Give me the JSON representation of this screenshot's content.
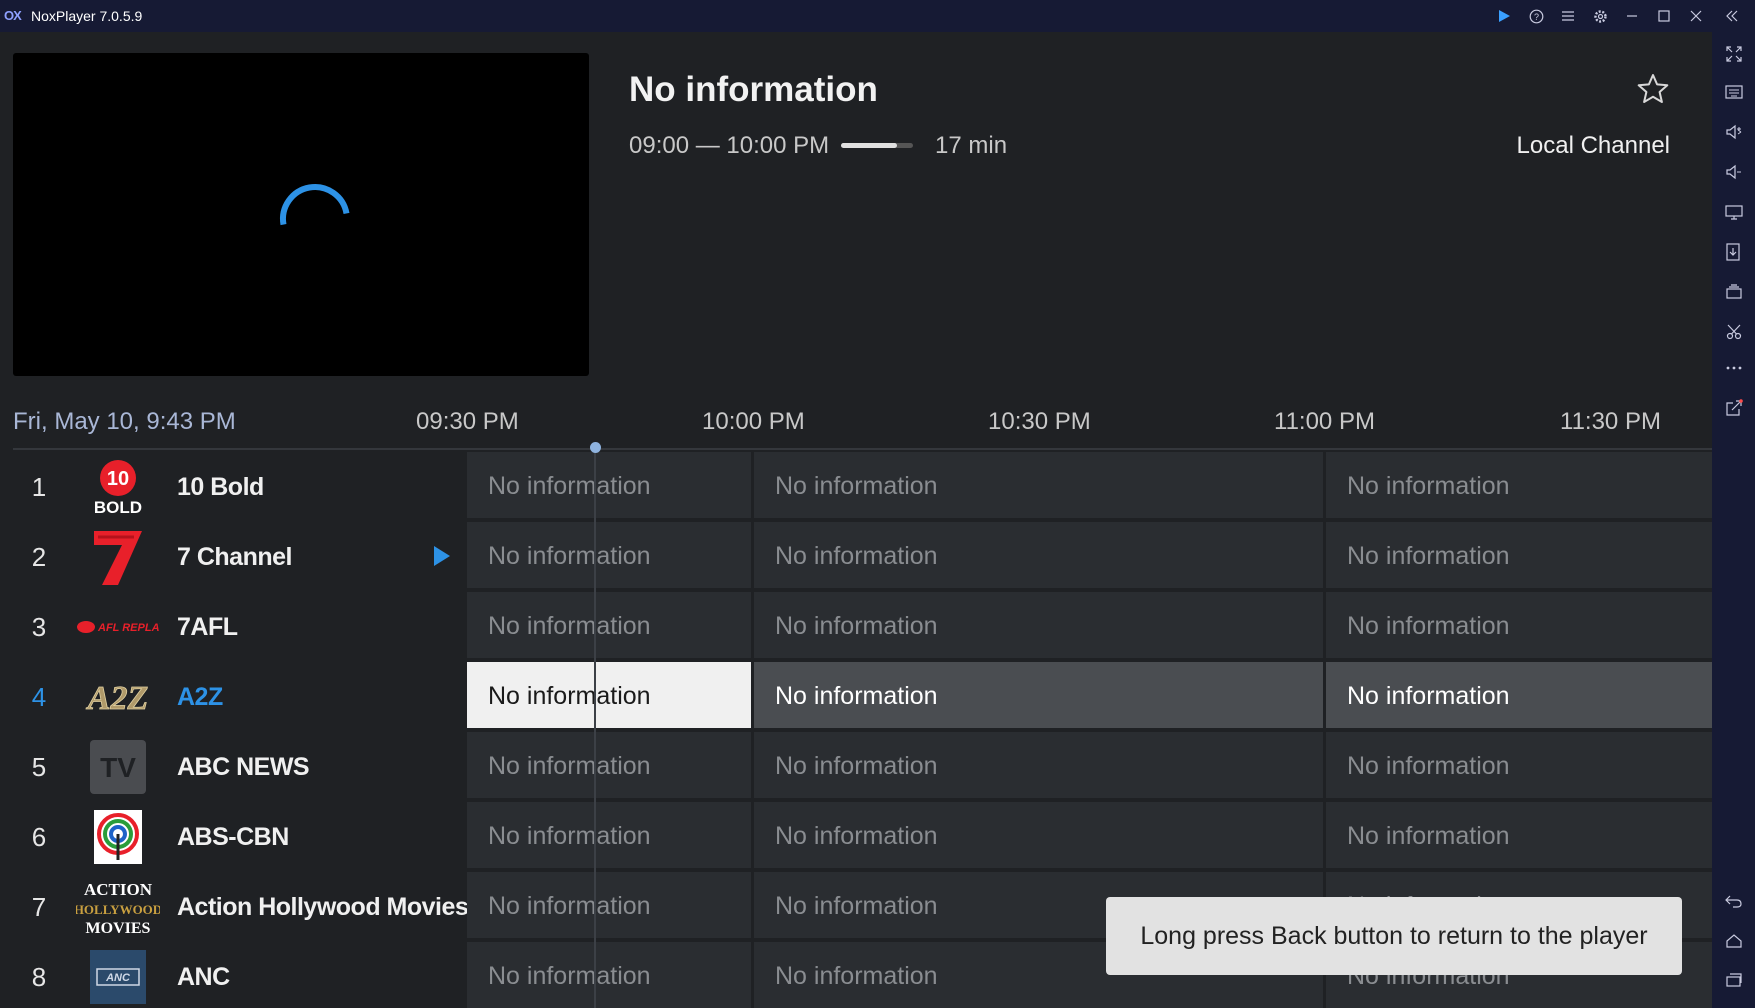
{
  "window": {
    "title": "NoxPlayer 7.0.5.9",
    "logo_text": "OX"
  },
  "program": {
    "title": "No information",
    "time_range": "09:00 — 10:00 PM",
    "progress": 0.78,
    "duration": "17 min",
    "channel_type": "Local Channel"
  },
  "timeline": {
    "now": "Fri, May 10, 9:43 PM",
    "slots": [
      "09:30 PM",
      "10:00 PM",
      "10:30 PM",
      "11:00 PM",
      "11:30 PM"
    ]
  },
  "channels": [
    {
      "number": "1",
      "name": "10 Bold",
      "logo": "10-bold-logo",
      "logo_text": "10",
      "logo_sub": "BOLD",
      "programs": [
        "No information",
        "No information",
        "No information"
      ]
    },
    {
      "number": "2",
      "name": "7 Channel",
      "logo": "seven-logo",
      "logo_text": "7",
      "playing": true,
      "programs": [
        "No information",
        "No information",
        "No information"
      ]
    },
    {
      "number": "3",
      "name": "7AFL",
      "logo": "afl-replays-logo",
      "logo_text": "AFL REPLAYS",
      "programs": [
        "No information",
        "No information",
        "No information"
      ]
    },
    {
      "number": "4",
      "name": "A2Z",
      "logo": "a2z-logo",
      "logo_text": "A2Z",
      "active": true,
      "programs": [
        "No information",
        "No information",
        "No information"
      ]
    },
    {
      "number": "5",
      "name": "ABC NEWS",
      "logo": "tv-logo",
      "logo_text": "TV",
      "programs": [
        "No information",
        "No information",
        "No information"
      ]
    },
    {
      "number": "6",
      "name": "ABS-CBN",
      "logo": "abs-cbn-logo",
      "logo_text": "",
      "programs": [
        "No information",
        "No information",
        "No information"
      ]
    },
    {
      "number": "7",
      "name": "Action Hollywood Movies",
      "logo": "action-hollywood-logo",
      "logo_text": "ACTION HOLLYWOOD MOVIES",
      "programs": [
        "No information",
        "No information",
        "No information"
      ]
    },
    {
      "number": "8",
      "name": "ANC",
      "logo": "anc-logo",
      "logo_text": "ANC",
      "programs": [
        "No information",
        "No information",
        "No information"
      ]
    }
  ],
  "toast": "Long press Back button to return to the player",
  "colors": {
    "accent": "#2d92e6",
    "titlebar": "#161a34",
    "background": "#1f2124"
  },
  "titlebar_icons": [
    "play-store-icon",
    "help-icon",
    "menu-icon",
    "settings-icon",
    "minimize-icon",
    "maximize-icon",
    "close-icon",
    "collapse-sidebar-icon"
  ],
  "sidebar_icons": [
    "fullscreen-icon",
    "keyboard-icon",
    "volume-up-icon",
    "volume-down-icon",
    "screen-icon",
    "apk-install-icon",
    "multi-instance-icon",
    "screenshot-icon",
    "more-icon",
    "external-icon",
    "back-icon",
    "home-icon",
    "recent-apps-icon"
  ]
}
